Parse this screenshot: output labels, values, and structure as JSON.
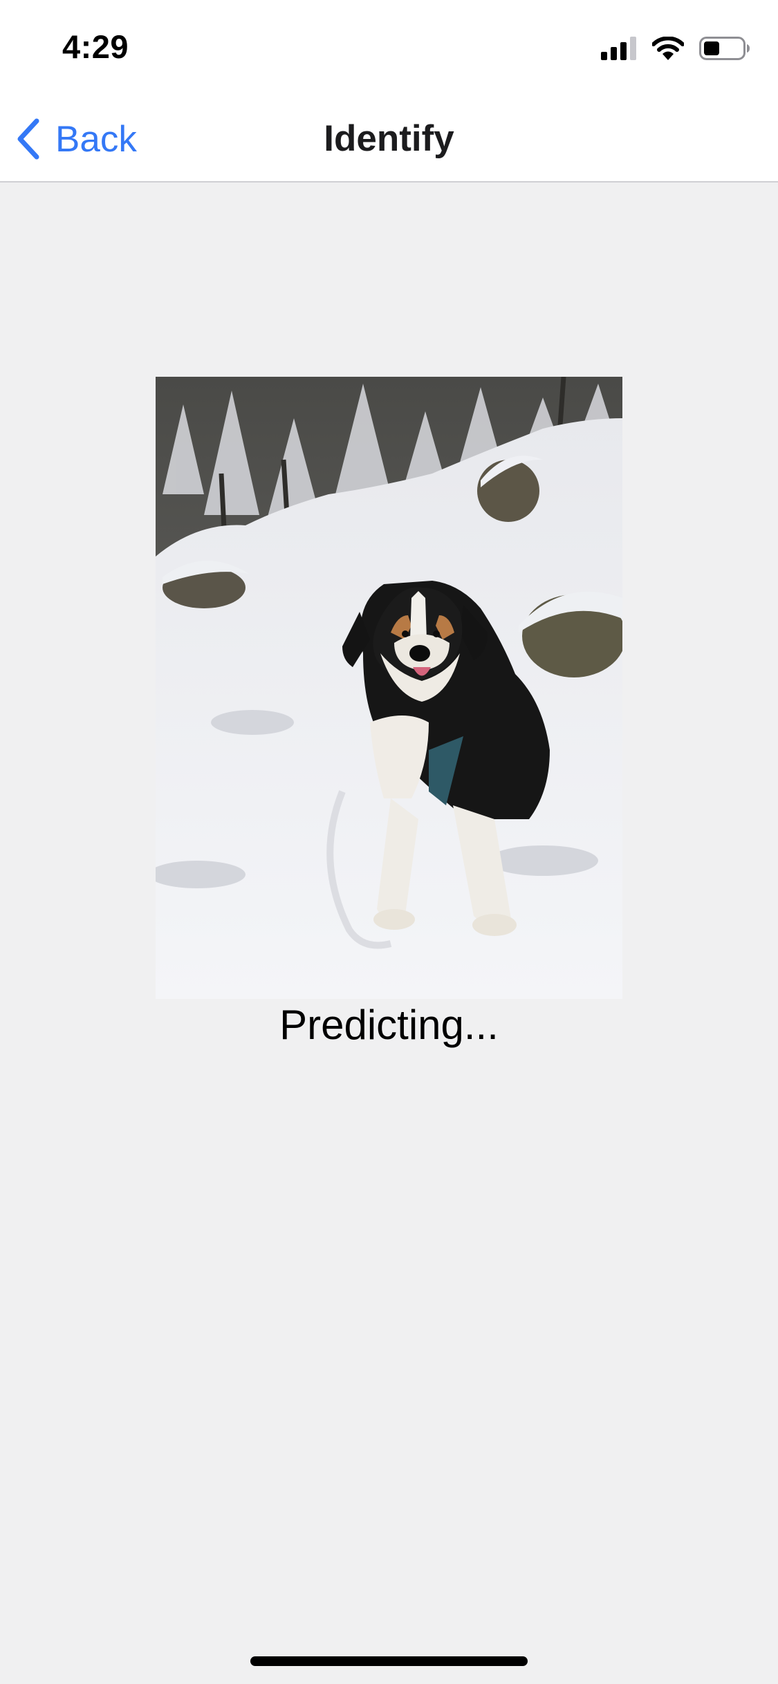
{
  "status_bar": {
    "time": "4:29",
    "icons": [
      "cellular-signal-icon",
      "wifi-icon",
      "battery-icon"
    ]
  },
  "nav": {
    "back_label": "Back",
    "back_icon": "chevron-left-icon",
    "title": "Identify"
  },
  "main": {
    "photo_icon": "dog-in-snow-photo",
    "prediction_text": "Predicting..."
  },
  "colors": {
    "accent": "#3478f6",
    "background": "#f0f0f1",
    "nav_background": "#ffffff",
    "divider": "#cfcfd3"
  }
}
